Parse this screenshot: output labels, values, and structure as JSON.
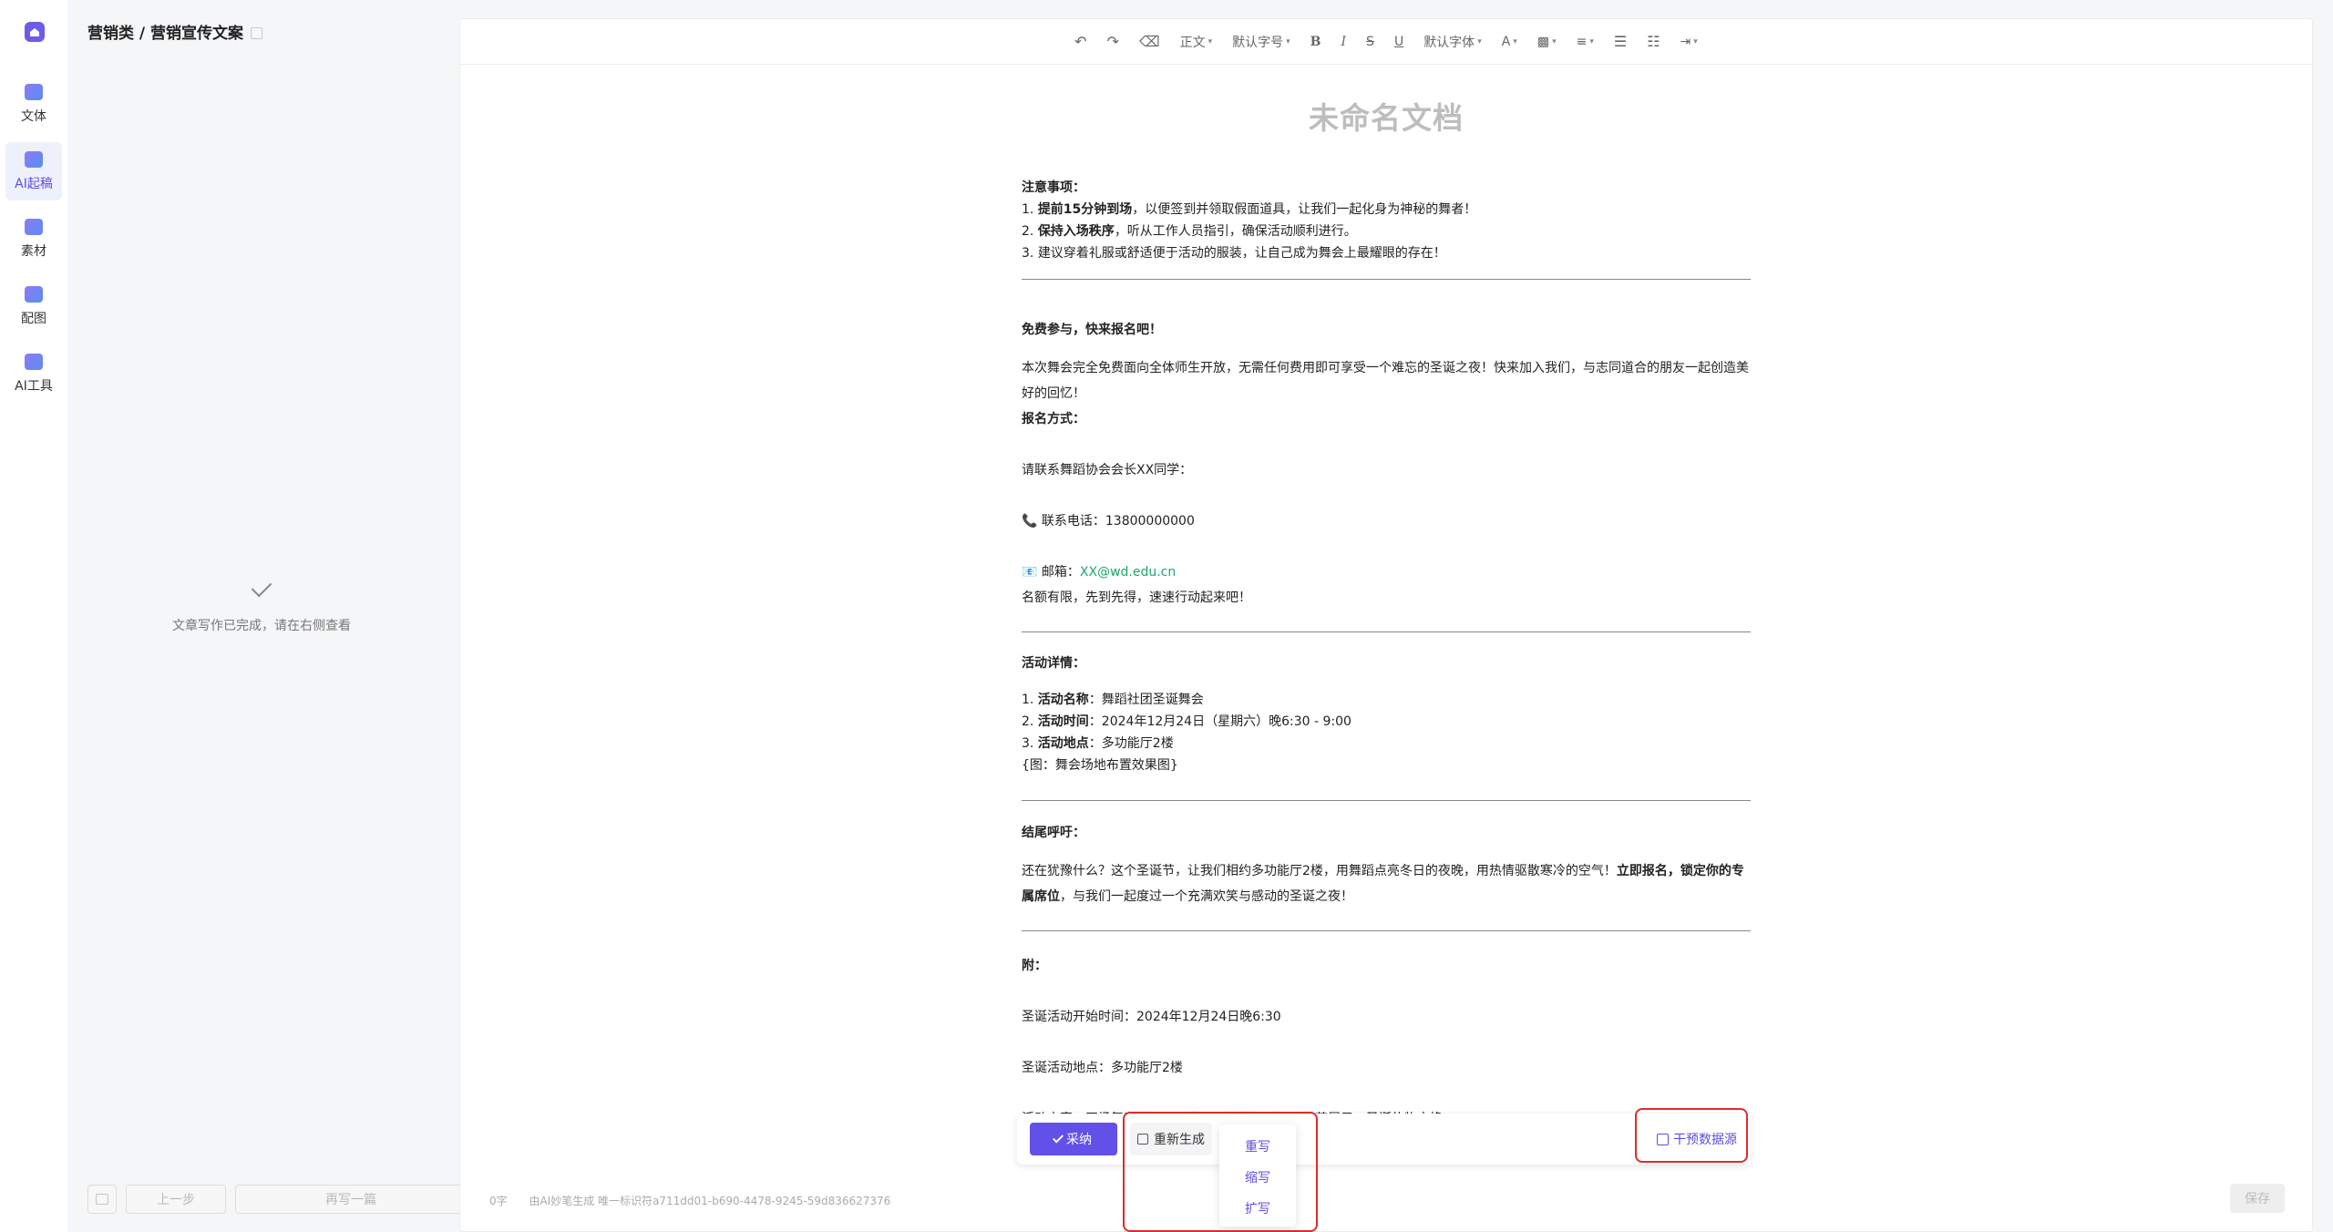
{
  "nav": {
    "items": [
      {
        "label": "文体"
      },
      {
        "label": "AI起稿"
      },
      {
        "label": "素材"
      },
      {
        "label": "配图"
      },
      {
        "label": "AI工具"
      }
    ]
  },
  "breadcrumb": "营销类 / 营销宣传文案",
  "status": {
    "done_text": "文章写作已完成，请在右侧查看"
  },
  "mid_footer": {
    "prev_label": "上一步",
    "rewrite_label": "再写一篇"
  },
  "toolbar": {
    "paragraph": "正文",
    "font_size": "默认字号",
    "bold": "B",
    "italic": "I",
    "strike": "S",
    "underline": "U",
    "font_family": "默认字体",
    "font_color": "A"
  },
  "doc": {
    "title": "未命名文档",
    "notes_heading": "注意事项：",
    "note1_bold": "提前15分钟到场",
    "note1_rest": "，以便签到并领取假面道具，让我们一起化身为神秘的舞者！",
    "note2_bold": "保持入场秩序",
    "note2_rest": "，听从工作人员指引，确保活动顺利进行。",
    "note3": "建议穿着礼服或舒适便于活动的服装，让自己成为舞会上最耀眼的存在！",
    "free_heading": "免费参与，快来报名吧！",
    "free_text": "本次舞会完全免费面向全体师生开放，无需任何费用即可享受一个难忘的圣诞之夜！快来加入我们，与志同道合的朋友一起创造美好的回忆！",
    "signup_heading": "报名方式：",
    "contact_line": "请联系舞蹈协会会长XX同学：",
    "phone_line": "📞 联系电话：13800000000",
    "email_prefix": "📧 邮箱：",
    "email": "XX@wd.edu.cn",
    "hurry": "名额有限，先到先得，速速行动起来吧！",
    "details_heading": "活动详情：",
    "d1_bold": "活动名称",
    "d1_rest": "：舞蹈社团圣诞舞会",
    "d2_bold": "活动时间",
    "d2_rest": "：2024年12月24日（星期六）晚6:30 - 9:00",
    "d3_bold": "活动地点",
    "d3_rest": "：多功能厅2楼",
    "image_placeholder": "{图：舞会场地布置效果图}",
    "closing_heading": "结尾呼吁：",
    "closing_text_a": "还在犹豫什么？这个圣诞节，让我们相约多功能厅2楼，用舞蹈点亮冬日的夜晚，用热情驱散寒冷的空气！",
    "closing_text_bold": "立即报名，锁定你的专属席位",
    "closing_text_b": "，与我们一起度过一个充满欢笑与感动的圣诞之夜！",
    "appendix_heading": "附：",
    "start_time": "圣诞活动开始时间：2024年12月24日晚6:30",
    "location": "圣诞活动地点：多功能厅2楼",
    "content": "活动内容：开场舞表演、互动游戏、自由舞时间、才艺展示、圣诞礼物交换"
  },
  "actionbar": {
    "adopt_label": "采纳",
    "regenerate_label": "重新生成",
    "intervene_label": "干预数据源",
    "menu": [
      "重写",
      "缩写",
      "扩写"
    ]
  },
  "footer": {
    "word_count": "0字",
    "ai_note": "由AI妙笔生成 唯一标识符a711dd01-b690-4478-9245-59d836627376",
    "save_label": "保存"
  }
}
